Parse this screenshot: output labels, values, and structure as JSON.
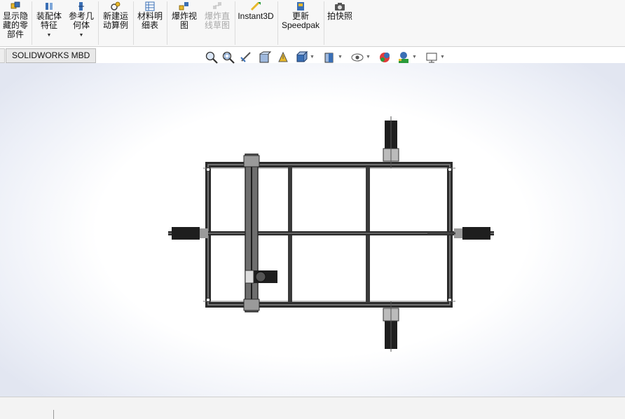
{
  "ribbon": {
    "buttons": [
      {
        "id": "show-hidden",
        "label": "显示隐\n藏的零\n部件",
        "enabled": true
      },
      {
        "id": "assembly-features",
        "label": "装配体\n特征",
        "enabled": true,
        "dropdown": true
      },
      {
        "id": "reference-geometry",
        "label": "参考几\n何体",
        "enabled": true,
        "dropdown": true
      },
      {
        "id": "new-motion-study",
        "label": "新建运\n动算例",
        "enabled": true
      },
      {
        "id": "bill-of-materials",
        "label": "材料明\n细表",
        "enabled": true
      },
      {
        "id": "exploded-view",
        "label": "爆炸视\n图",
        "enabled": true
      },
      {
        "id": "explode-line-sketch",
        "label": "爆炸直\n线草图",
        "enabled": false
      },
      {
        "id": "instant3d",
        "label": "Instant3D",
        "enabled": true
      },
      {
        "id": "update-speedpak",
        "label": "更新\nSpeedpak",
        "enabled": true
      },
      {
        "id": "take-snapshot",
        "label": "拍快照",
        "enabled": true
      }
    ]
  },
  "tabs": [
    {
      "label": "SOLIDWORKS MBD"
    }
  ],
  "heads_up_toolbar": [
    "zoom-to-fit-icon",
    "zoom-to-area-icon",
    "previous-view-icon",
    "section-view-icon",
    "dynamic-annotation-icon",
    "view-orientation-icon",
    "display-style-icon",
    "hide-show-items-icon",
    "edit-appearance-icon",
    "apply-scene-icon",
    "view-settings-icon"
  ],
  "colors": {
    "ribbon_bg": "#f7f7f7",
    "viewport_edge": "#e2e6f1",
    "frame_dark": "#2b2b2b",
    "frame_mid": "#6e6e6e",
    "icon_blue": "#3a6fb5",
    "icon_yellow": "#e8b82a"
  }
}
